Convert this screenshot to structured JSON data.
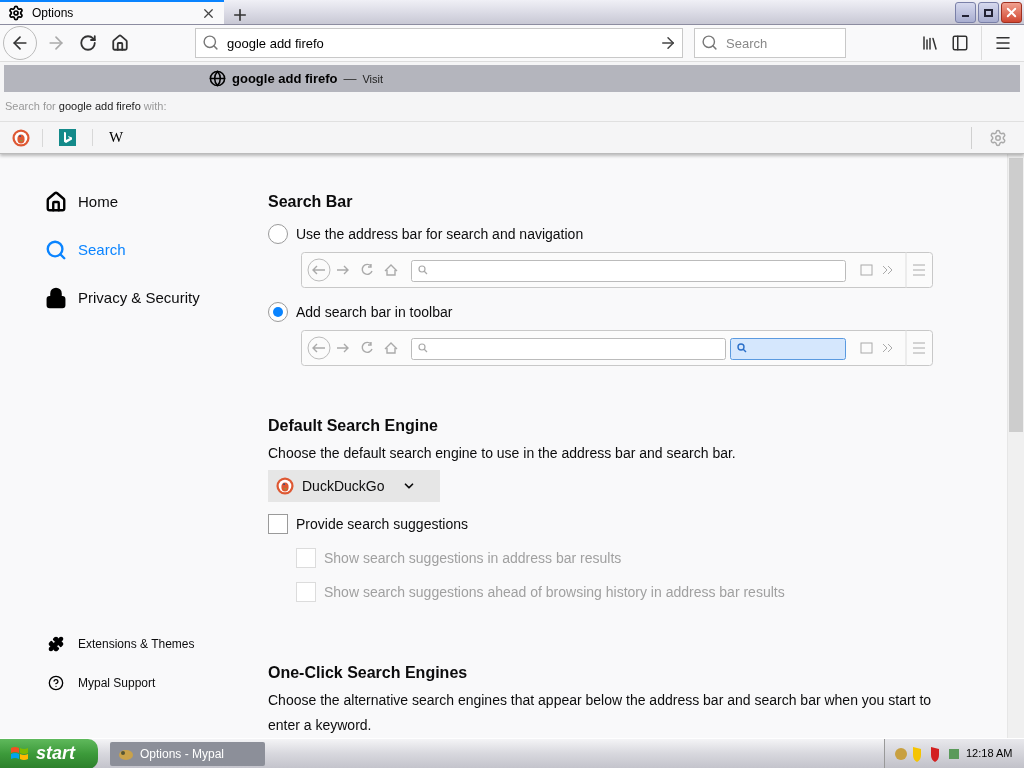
{
  "tab": {
    "title": "Options",
    "selected": true
  },
  "address_bar": {
    "value": "google add firefo"
  },
  "search_field": {
    "placeholder": "Search"
  },
  "url_popup": {
    "result": {
      "title": "google add firefo",
      "separator": "—",
      "action": "Visit",
      "selected": true
    },
    "search_with": {
      "prefix": "Search for ",
      "query": "google add firefo",
      "suffix": " with:"
    },
    "engines": [
      {
        "kind": "duckduckgo"
      },
      {
        "kind": "bing"
      },
      {
        "kind": "wikipedia",
        "label": "W"
      }
    ]
  },
  "sidebar": {
    "items": [
      {
        "label": "Home",
        "selected": false
      },
      {
        "label": "Search",
        "selected": true
      },
      {
        "label": "Privacy & Security",
        "selected": false
      }
    ],
    "footer": [
      {
        "label": "Extensions & Themes"
      },
      {
        "label": "Mypal Support"
      }
    ]
  },
  "page": {
    "search_bar": {
      "heading": "Search Bar",
      "options": [
        {
          "label": "Use the address bar for search and navigation",
          "selected": false
        },
        {
          "label": "Add search bar in toolbar",
          "selected": true
        }
      ]
    },
    "default_engine": {
      "heading": "Default Search Engine",
      "description": "Choose the default search engine to use in the address bar and search bar.",
      "engine": "DuckDuckGo",
      "checkboxes": [
        {
          "label": "Provide search suggestions",
          "checked": false,
          "disabled": false,
          "children": [
            {
              "label": "Show search suggestions in address bar results",
              "checked": false,
              "disabled": true
            },
            {
              "label": "Show search suggestions ahead of browsing history in address bar results",
              "checked": false,
              "disabled": true
            }
          ]
        }
      ]
    },
    "one_click": {
      "heading": "One-Click Search Engines",
      "description": "Choose the alternative search engines that appear below the address bar and search bar when you start to enter a keyword."
    }
  },
  "taskbar": {
    "start": "start",
    "tasks": [
      {
        "label": "Options - Mypal",
        "selected": true
      }
    ],
    "clock": "12:18 AM"
  }
}
